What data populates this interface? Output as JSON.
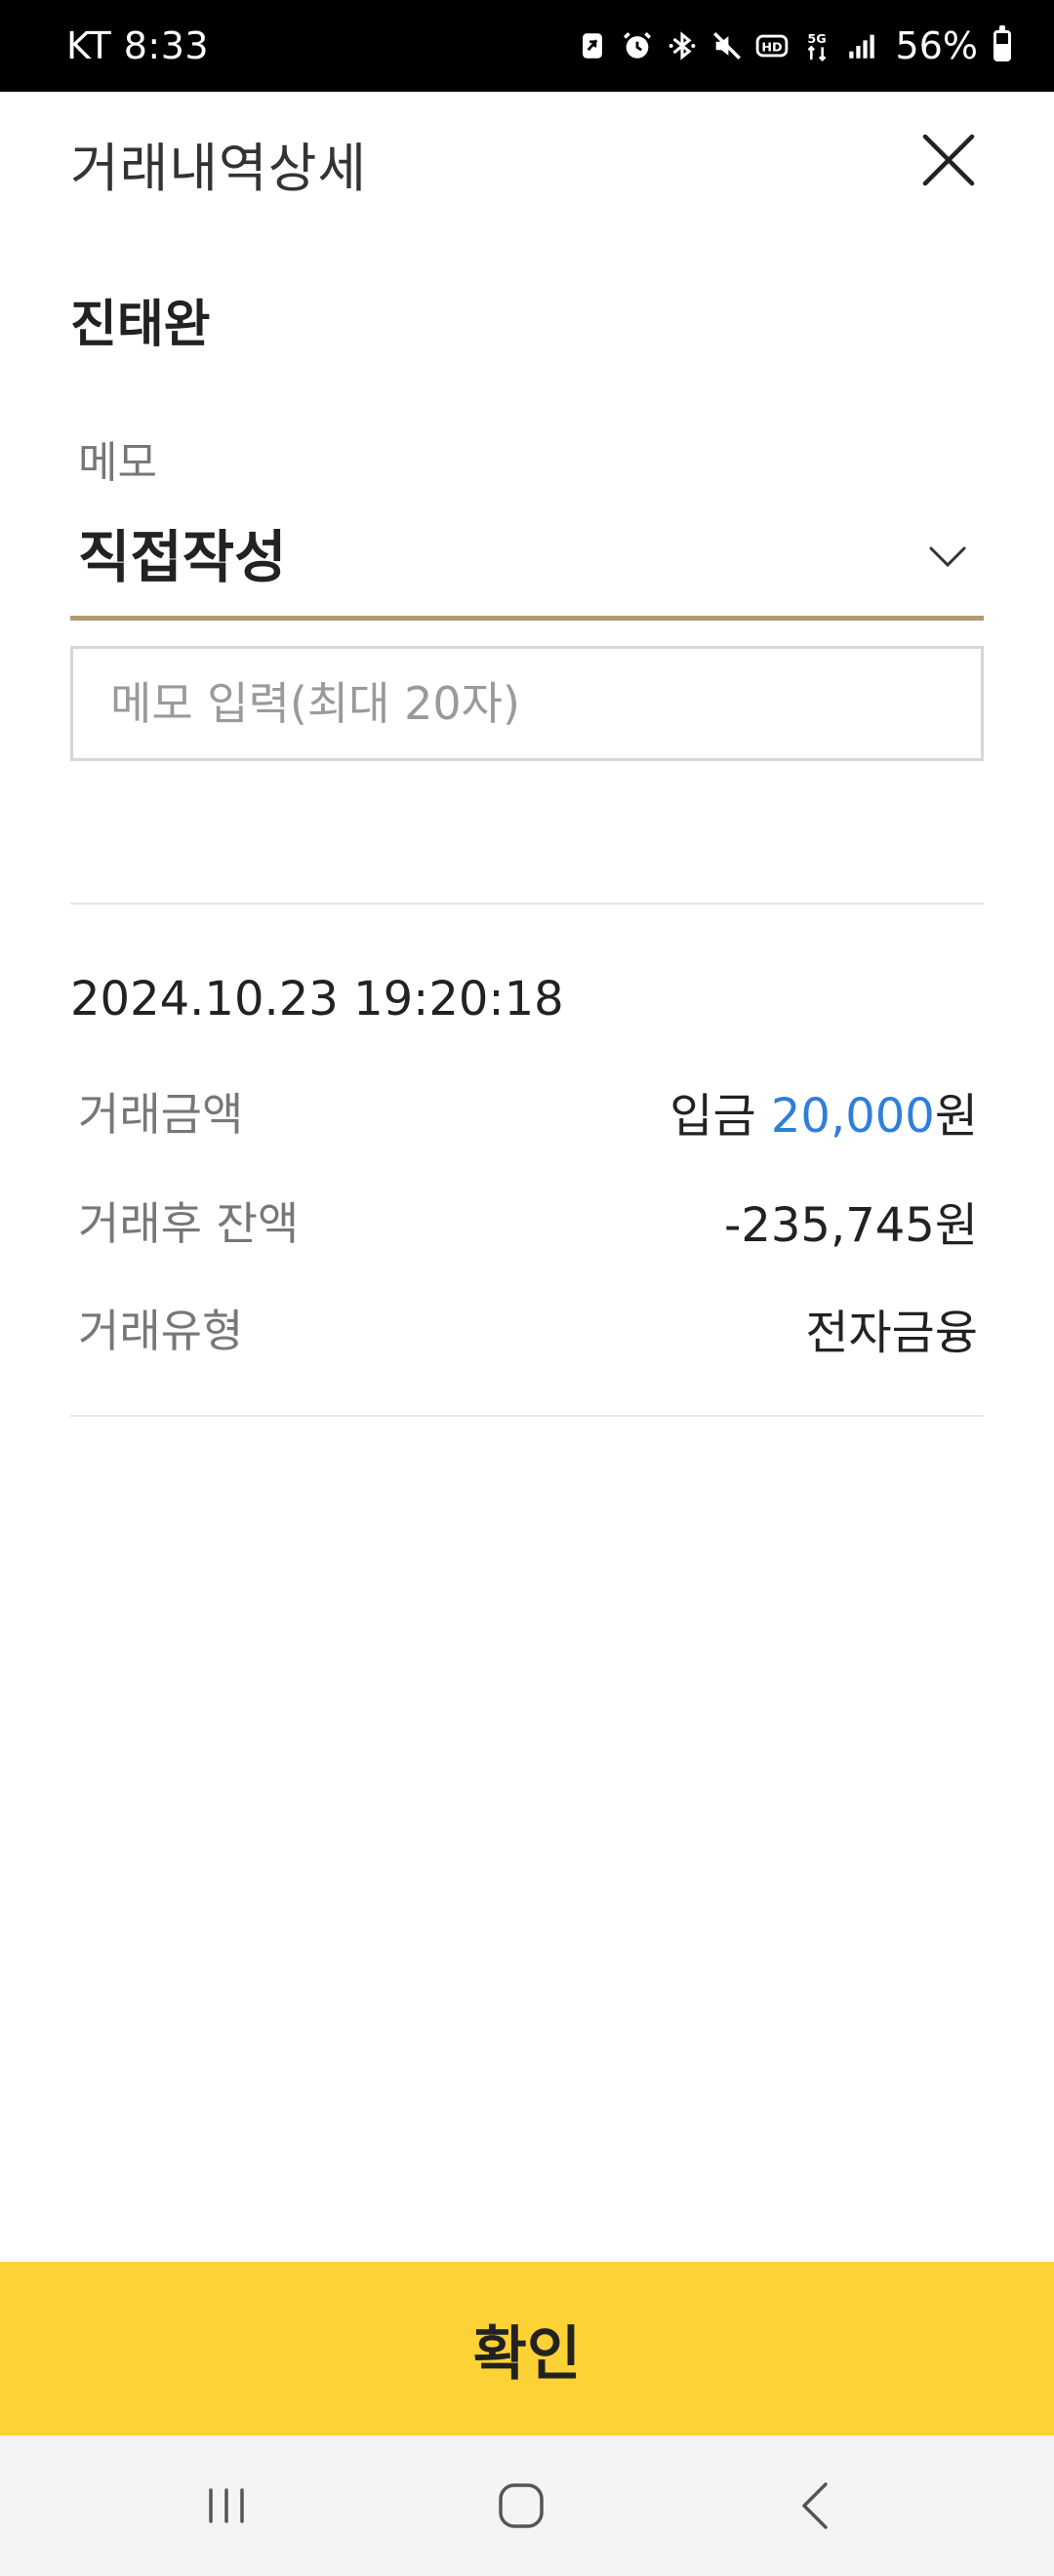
{
  "status_bar": {
    "carrier_time": "KT 8:33",
    "battery_percent": "56%",
    "battery_level": 0.56,
    "icons": [
      "notification-icon",
      "alarm-icon",
      "bluetooth-icon",
      "mute-icon",
      "hd-icon",
      "5g-icon",
      "signal-icon",
      "battery-icon"
    ]
  },
  "header": {
    "title": "거래내역상세"
  },
  "account_holder": "진태완",
  "memo": {
    "label": "메모",
    "selected_option": "직접작성",
    "input_placeholder": "메모 입력(최대 20자)",
    "input_value": ""
  },
  "transaction": {
    "datetime": "2024.10.23 19:20:18",
    "amount_label": "거래금액",
    "amount_type": "입금",
    "amount_value": "20,000",
    "amount_unit": "원",
    "balance_label": "거래후 잔액",
    "balance_value": "-235,745",
    "balance_unit": "원",
    "type_label": "거래유형",
    "type_value": "전자금융"
  },
  "confirm_label": "확인",
  "colors": {
    "accent_yellow": "#fdd236",
    "underline_gold": "#b29a73",
    "amount_blue": "#2f7fd8"
  }
}
